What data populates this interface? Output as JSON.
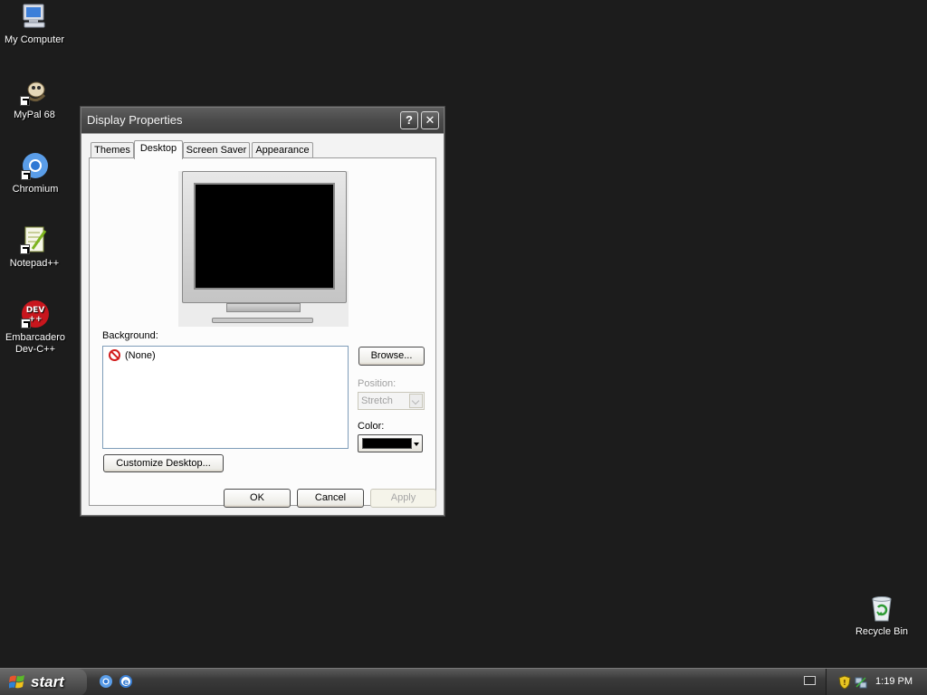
{
  "desktop": {
    "icons": [
      {
        "label": "My Computer",
        "icon": "my-computer-icon"
      },
      {
        "label": "MyPal 68",
        "icon": "mypal-icon"
      },
      {
        "label": "Chromium",
        "icon": "chromium-icon"
      },
      {
        "label": "Notepad++",
        "icon": "notepad-plus-plus-icon"
      },
      {
        "label": "Embarcadero Dev-C++",
        "icon": "devcpp-icon"
      }
    ],
    "recycle_bin": {
      "label": "Recycle Bin",
      "icon": "recycle-bin-icon"
    }
  },
  "dialog": {
    "title": "Display Properties",
    "help_label": "?",
    "close_label": "✕",
    "tabs": [
      {
        "label": "Themes",
        "active": false
      },
      {
        "label": "Desktop",
        "active": true
      },
      {
        "label": "Screen Saver",
        "active": false
      },
      {
        "label": "Appearance",
        "active": false
      }
    ],
    "background_label": "Background:",
    "background_items": [
      {
        "label": "(None)",
        "icon": "none-icon"
      }
    ],
    "browse_label": "Browse...",
    "position_label": "Position:",
    "position_value": "Stretch",
    "color_label": "Color:",
    "color_value": "#000000",
    "customize_label": "Customize Desktop...",
    "ok_label": "OK",
    "cancel_label": "Cancel",
    "apply_label": "Apply"
  },
  "taskbar": {
    "start_label": "start",
    "quick_launch": [
      "chromium-icon",
      "internet-explorer-icon"
    ],
    "tray_icons": [
      "keyboard-icon",
      "security-shield-icon",
      "network-icon"
    ],
    "clock": "1:19 PM"
  },
  "colors": {
    "desktop_bg": "#1c1c1c",
    "dialog_bg": "#ece9d8",
    "titlebar": "#4a4a4a",
    "taskbar": "#3a3a3a"
  }
}
